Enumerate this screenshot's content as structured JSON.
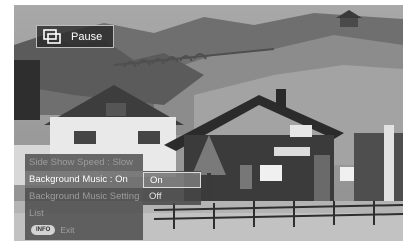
{
  "slideshow": {
    "pause_label": "Pause",
    "pause_icon": "slideshow-icon"
  },
  "menu": {
    "items": [
      {
        "label": "Side Show Speed : Slow",
        "selected": false
      },
      {
        "label": "Background Music : On",
        "selected": true
      },
      {
        "label": "Background Music Setting",
        "selected": false
      },
      {
        "label": "List",
        "selected": false
      }
    ],
    "footer_badge": "INFO",
    "footer_label": "Exit"
  },
  "submenu": {
    "options": [
      {
        "label": "On",
        "selected": true
      },
      {
        "label": "Off",
        "selected": false
      }
    ]
  }
}
